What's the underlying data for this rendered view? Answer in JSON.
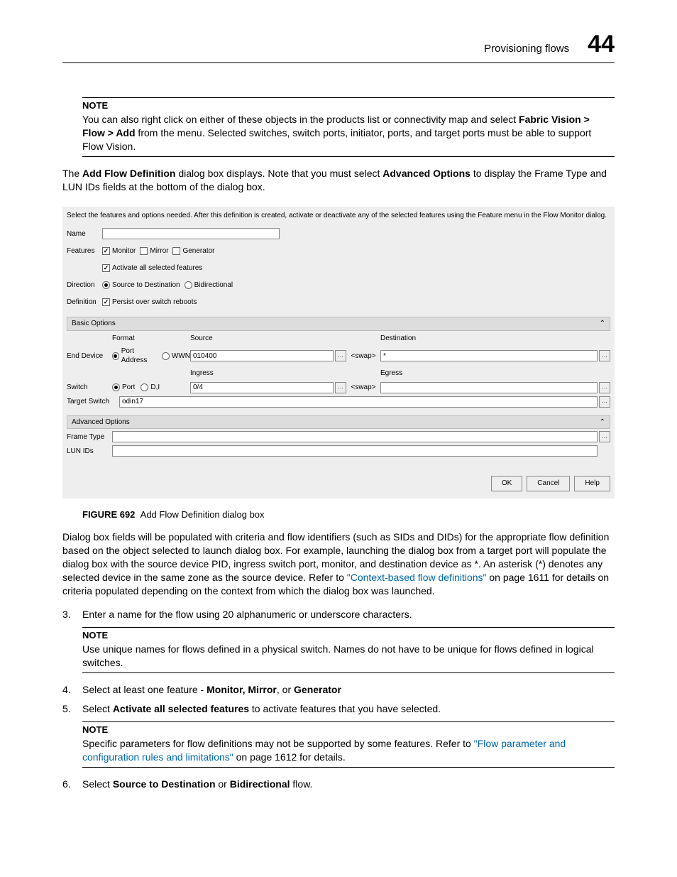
{
  "header": {
    "title": "Provisioning flows",
    "chapter": "44"
  },
  "note1": {
    "label": "NOTE",
    "text_a": "You can also right click on either of these objects in the products list or connectivity map and select ",
    "text_b": "Fabric Vision > Flow > Add",
    "text_c": " from the menu. Selected switches, switch ports, initiator, ports, and target ports must be able to support Flow Vision."
  },
  "para1": {
    "a": "The ",
    "b": "Add Flow Definition",
    "c": " dialog box displays. Note that you must select ",
    "d": "Advanced Options",
    "e": " to display the Frame Type and LUN IDs fields at the bottom of the dialog box."
  },
  "dialog": {
    "instruction": "Select the features and options needed. After this definition is created, activate or deactivate any of the selected features using the Feature menu in the Flow Monitor dialog.",
    "labels": {
      "name": "Name",
      "features": "Features",
      "direction": "Direction",
      "definition": "Definition",
      "basic": "Basic Options",
      "advanced": "Advanced Options",
      "format": "Format",
      "source": "Source",
      "destination": "Destination",
      "end_device": "End Device",
      "switch": "Switch",
      "target_switch": "Target Switch",
      "ingress": "Ingress",
      "egress": "Egress",
      "frame_type": "Frame Type",
      "lun_ids": "LUN IDs"
    },
    "features": {
      "monitor": "Monitor",
      "mirror": "Mirror",
      "generator": "Generator",
      "activate_all": "Activate all selected features"
    },
    "direction": {
      "s2d": "Source to Destination",
      "bidi": "Bidirectional"
    },
    "definition": {
      "persist": "Persist over switch reboots"
    },
    "end_device_opts": {
      "port_addr": "Port Address",
      "wwn": "WWN"
    },
    "switch_opts": {
      "port": "Port",
      "di": "D,I"
    },
    "values": {
      "name": "",
      "source_val": "010400",
      "dest_val": "*",
      "ingress_val": "0/4",
      "egress_val": "",
      "target_switch_val": "odin17",
      "swap": "<swap>",
      "frame_type_val": "",
      "lun_ids_val": ""
    },
    "buttons": {
      "ok": "OK",
      "cancel": "Cancel",
      "help": "Help"
    }
  },
  "figure": {
    "label": "FIGURE 692",
    "caption": "Add Flow Definition dialog box"
  },
  "para2": {
    "a": "Dialog box fields will be populated with criteria and flow identifiers (such as SIDs and DIDs) for the appropriate flow definition based on the object selected to launch dialog box. For example, launching the dialog box from a target port will populate the dialog box with the source device PID, ingress switch port, monitor, and destination device as *. An asterisk (*) denotes any selected device in the same zone as the source device. Refer to ",
    "link": "\"Context-based flow definitions\"",
    "b": " on page 1611 for details on criteria populated depending on the context from which the dialog box was launched."
  },
  "steps": {
    "s3": {
      "n": "3.",
      "t": "Enter a name for the flow using 20 alphanumeric or underscore characters."
    },
    "note2": {
      "label": "NOTE",
      "t": "Use unique names for flows defined in a physical switch. Names do not have to be unique for flows defined in logical switches."
    },
    "s4": {
      "n": "4.",
      "a": "Select at least one feature - ",
      "b": "Monitor, Mirror",
      "c": ", or ",
      "d": "Generator"
    },
    "s5": {
      "n": "5.",
      "a": "Select ",
      "b": "Activate all selected features",
      "c": " to activate features that you have selected."
    },
    "note3": {
      "label": "NOTE",
      "a": "Specific parameters for flow definitions may not be supported by some features. Refer to ",
      "link": "\"Flow parameter and configuration rules and limitations\"",
      "b": " on page 1612 for details."
    },
    "s6": {
      "n": "6.",
      "a": "Select ",
      "b": "Source to Destination",
      "c": " or ",
      "d": "Bidirectional",
      "e": " flow."
    }
  }
}
